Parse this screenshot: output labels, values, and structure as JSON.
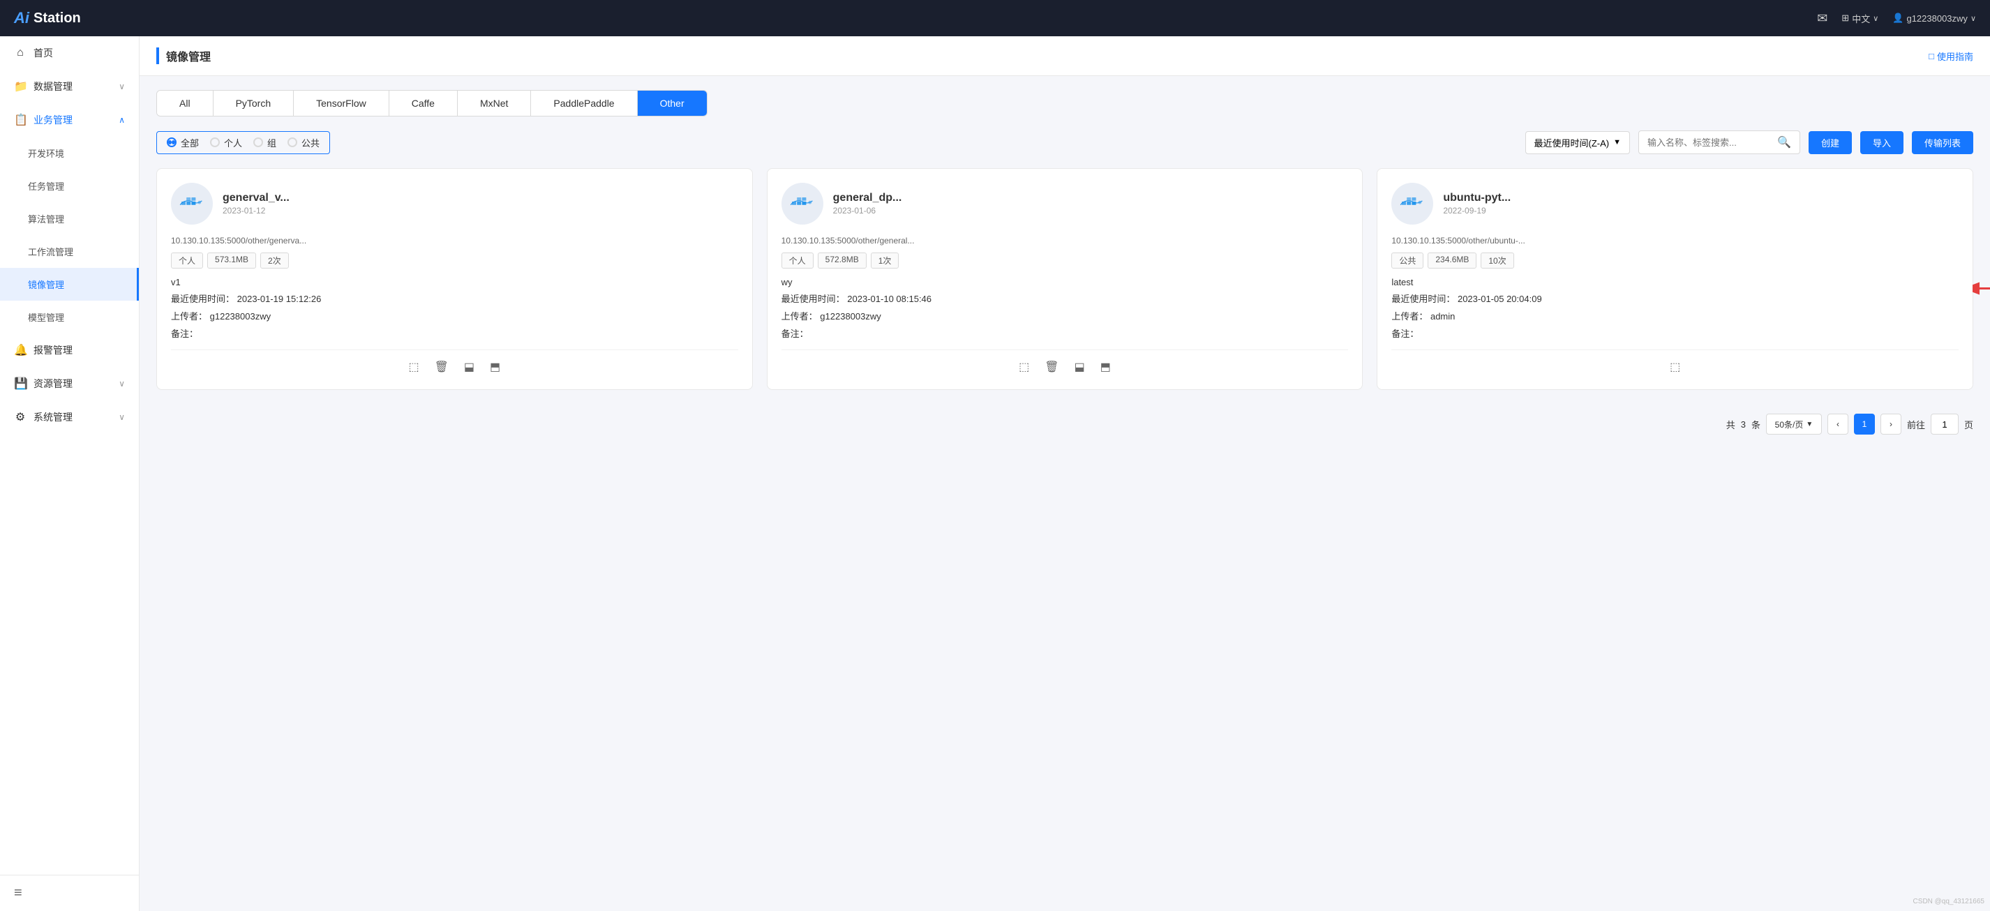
{
  "brand": {
    "ai": "Ai",
    "station": "Station"
  },
  "navbar": {
    "email_icon": "✉",
    "translate_icon": "⊞",
    "language": "中文",
    "user_icon": "👤",
    "username": "g12238003zwy",
    "chevron": "∨"
  },
  "sidebar": {
    "items": [
      {
        "id": "home",
        "label": "首页",
        "icon": "⌂",
        "level": "top",
        "has_children": false
      },
      {
        "id": "data-mgmt",
        "label": "数据管理",
        "icon": "📁",
        "level": "top",
        "has_children": true
      },
      {
        "id": "business-mgmt",
        "label": "业务管理",
        "icon": "📋",
        "level": "top",
        "has_children": true,
        "expanded": true
      },
      {
        "id": "dev-env",
        "label": "开发环境",
        "icon": "",
        "level": "sub",
        "has_children": false
      },
      {
        "id": "task-mgmt",
        "label": "任务管理",
        "icon": "",
        "level": "sub",
        "has_children": false
      },
      {
        "id": "algo-mgmt",
        "label": "算法管理",
        "icon": "",
        "level": "sub",
        "has_children": false
      },
      {
        "id": "workflow-mgmt",
        "label": "工作流管理",
        "icon": "",
        "level": "sub",
        "has_children": false
      },
      {
        "id": "image-mgmt",
        "label": "镜像管理",
        "icon": "",
        "level": "sub",
        "has_children": false,
        "active": true
      },
      {
        "id": "model-mgmt",
        "label": "模型管理",
        "icon": "",
        "level": "sub",
        "has_children": false
      },
      {
        "id": "report-mgmt",
        "label": "报警管理",
        "icon": "🔔",
        "level": "top",
        "has_children": false
      },
      {
        "id": "resource-mgmt",
        "label": "资源管理",
        "icon": "💾",
        "level": "top",
        "has_children": true
      },
      {
        "id": "sys-mgmt",
        "label": "系统管理",
        "icon": "⚙",
        "level": "top",
        "has_children": true
      }
    ],
    "collapse_icon": "≡"
  },
  "page": {
    "title": "镜像管理",
    "help_label": "使用指南",
    "help_icon": "□"
  },
  "filter_tabs": [
    {
      "id": "all",
      "label": "All",
      "active": false
    },
    {
      "id": "pytorch",
      "label": "PyTorch",
      "active": false
    },
    {
      "id": "tensorflow",
      "label": "TensorFlow",
      "active": false
    },
    {
      "id": "caffe",
      "label": "Caffe",
      "active": false
    },
    {
      "id": "mxnet",
      "label": "MxNet",
      "active": false
    },
    {
      "id": "paddlepaddle",
      "label": "PaddlePaddle",
      "active": false
    },
    {
      "id": "other",
      "label": "Other",
      "active": true
    }
  ],
  "toolbar": {
    "radio_options": [
      {
        "id": "all",
        "label": "全部",
        "checked": true
      },
      {
        "id": "personal",
        "label": "个人",
        "checked": false
      },
      {
        "id": "group",
        "label": "组",
        "checked": false
      },
      {
        "id": "public",
        "label": "公共",
        "checked": false
      }
    ],
    "sort_label": "最近使用时间(Z-A)",
    "sort_chevron": "▼",
    "search_placeholder": "输入名称、标签搜索...",
    "search_icon": "🔍",
    "btn_create": "创建",
    "btn_import": "导入",
    "btn_transfer": "传输列表"
  },
  "cards": [
    {
      "id": "card1",
      "name": "generval_v...",
      "date": "2023-01-12",
      "url": "10.130.10.135:5000/other/generva...",
      "tags": [
        {
          "label": "个人"
        },
        {
          "label": "573.1MB"
        },
        {
          "label": "2次"
        }
      ],
      "version": "v1",
      "last_used_label": "最近使用时间：",
      "last_used": "2023-01-19 15:12:26",
      "uploader_label": "上传者：",
      "uploader": "g12238003zwy",
      "note_label": "备注：",
      "note": "",
      "actions": [
        "export",
        "delete",
        "pull",
        "push"
      ]
    },
    {
      "id": "card2",
      "name": "general_dp...",
      "date": "2023-01-06",
      "url": "10.130.10.135:5000/other/general...",
      "tags": [
        {
          "label": "个人"
        },
        {
          "label": "572.8MB"
        },
        {
          "label": "1次"
        }
      ],
      "version": "wy",
      "last_used_label": "最近使用时间：",
      "last_used": "2023-01-10 08:15:46",
      "uploader_label": "上传者：",
      "uploader": "g12238003zwy",
      "note_label": "备注：",
      "note": "",
      "actions": [
        "export",
        "delete",
        "pull",
        "push"
      ]
    },
    {
      "id": "card3",
      "name": "ubuntu-pyt...",
      "date": "2022-09-19",
      "url": "10.130.10.135:5000/other/ubuntu-...",
      "tags": [
        {
          "label": "公共"
        },
        {
          "label": "234.6MB"
        },
        {
          "label": "10次"
        }
      ],
      "version": "latest",
      "last_used_label": "最近使用时间：",
      "last_used": "2023-01-05 20:04:09",
      "uploader_label": "上传者：",
      "uploader": "admin",
      "note_label": "备注：",
      "note": "",
      "actions": [
        "export"
      ]
    }
  ],
  "pagination": {
    "total_label": "共",
    "total": "3",
    "total_unit": "条",
    "per_page": "50条/页",
    "current_page": "1",
    "prev_icon": "‹",
    "next_icon": "›",
    "goto_label": "前往",
    "goto_unit": "页"
  },
  "watermark": "CSDN @qq_43121665"
}
